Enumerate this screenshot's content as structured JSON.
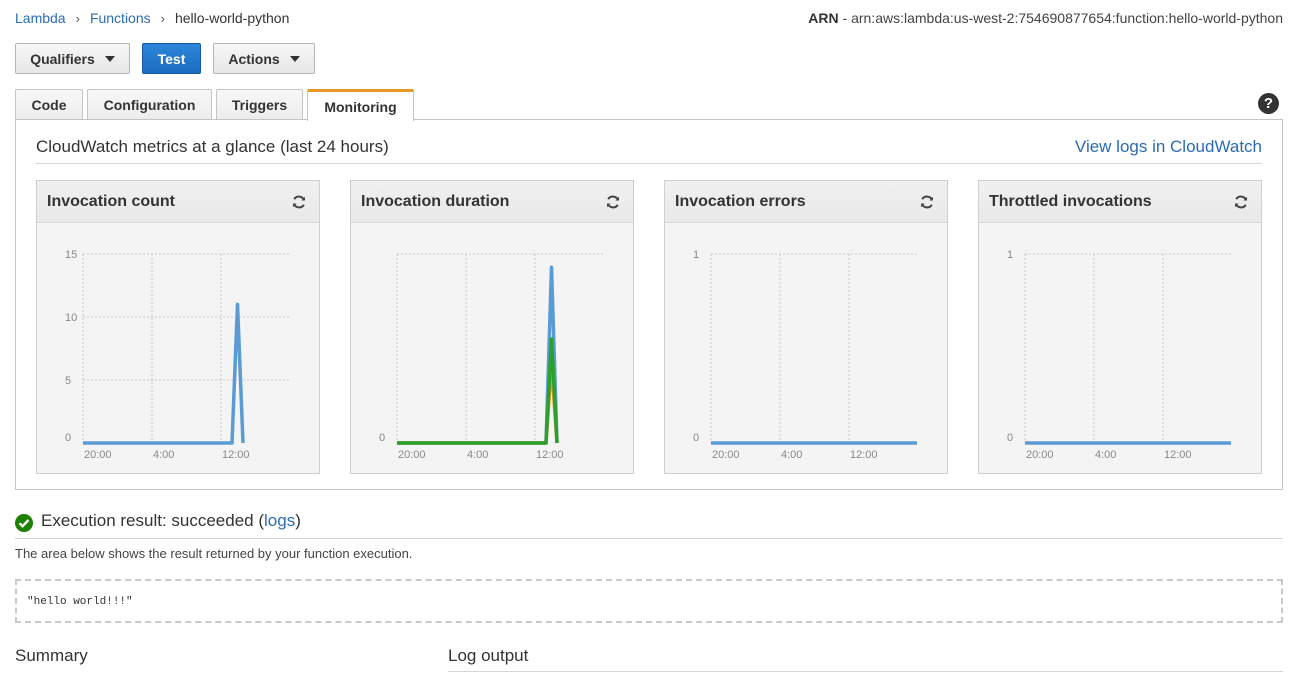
{
  "breadcrumb": {
    "lambda": "Lambda",
    "functions": "Functions",
    "current": "hello-world-python"
  },
  "arn": {
    "label": "ARN",
    "value": " - arn:aws:lambda:us-west-2:754690877654:function:hello-world-python"
  },
  "toolbar": {
    "qualifiers": "Qualifiers",
    "test": "Test",
    "actions": "Actions"
  },
  "tabs": {
    "code": "Code",
    "configuration": "Configuration",
    "triggers": "Triggers",
    "monitoring": "Monitoring"
  },
  "help_icon": "?",
  "monitoring": {
    "title": "CloudWatch metrics at a glance (last 24 hours)",
    "view_logs": "View logs in CloudWatch"
  },
  "colors": {
    "blue": "#5b9bd5",
    "green": "#2ca02c",
    "orange": "#e8941c",
    "accent": "#e79925",
    "link": "#2a6cb3"
  },
  "chart_data": [
    {
      "type": "line",
      "title": "Invocation count",
      "x_ticks": [
        "20:00",
        "4:00",
        "12:00"
      ],
      "y_ticks": [
        "0",
        "5",
        "10",
        "15"
      ],
      "ylim": [
        0,
        15
      ],
      "grid": true,
      "series": [
        {
          "color": "#5b9bd5",
          "values": [
            0,
            0,
            0,
            0,
            0,
            0,
            0,
            0,
            0,
            0,
            0,
            0,
            0,
            0,
            0,
            0,
            0,
            0,
            0,
            0,
            0,
            0,
            0,
            0,
            0,
            0,
            0,
            0,
            11,
            0
          ]
        }
      ]
    },
    {
      "type": "line",
      "title": "Invocation duration",
      "x_ticks": [
        "20:00",
        "4:00",
        "12:00"
      ],
      "y_ticks": [
        "0"
      ],
      "ylim": [
        0,
        100
      ],
      "grid": true,
      "series": [
        {
          "color": "#5b9bd5",
          "values": [
            0,
            0,
            0,
            0,
            0,
            0,
            0,
            0,
            0,
            0,
            0,
            0,
            0,
            0,
            0,
            0,
            0,
            0,
            0,
            0,
            0,
            0,
            0,
            0,
            0,
            0,
            0,
            0,
            93,
            0
          ]
        },
        {
          "color": "#e8941c",
          "values": [
            0,
            0,
            0,
            0,
            0,
            0,
            0,
            0,
            0,
            0,
            0,
            0,
            0,
            0,
            0,
            0,
            0,
            0,
            0,
            0,
            0,
            0,
            0,
            0,
            0,
            0,
            0,
            0,
            42,
            0
          ]
        },
        {
          "color": "#2ca02c",
          "values": [
            0,
            0,
            0,
            0,
            0,
            0,
            0,
            0,
            0,
            0,
            0,
            0,
            0,
            0,
            0,
            0,
            0,
            0,
            0,
            0,
            0,
            0,
            0,
            0,
            0,
            0,
            0,
            0,
            55,
            0
          ]
        }
      ]
    },
    {
      "type": "line",
      "title": "Invocation errors",
      "x_ticks": [
        "20:00",
        "4:00",
        "12:00"
      ],
      "y_ticks": [
        "0",
        "1"
      ],
      "ylim": [
        0,
        1
      ],
      "grid": true,
      "series": [
        {
          "color": "#5b9bd5",
          "values": [
            0,
            0,
            0,
            0,
            0,
            0,
            0,
            0,
            0,
            0,
            0,
            0,
            0,
            0,
            0,
            0,
            0,
            0,
            0,
            0,
            0,
            0,
            0,
            0,
            0,
            0,
            0,
            0,
            0,
            0
          ]
        }
      ]
    },
    {
      "type": "line",
      "title": "Throttled invocations",
      "x_ticks": [
        "20:00",
        "4:00",
        "12:00"
      ],
      "y_ticks": [
        "0",
        "1"
      ],
      "ylim": [
        0,
        1
      ],
      "grid": true,
      "series": [
        {
          "color": "#5b9bd5",
          "values": [
            0,
            0,
            0,
            0,
            0,
            0,
            0,
            0,
            0,
            0,
            0,
            0,
            0,
            0,
            0,
            0,
            0,
            0,
            0,
            0,
            0,
            0,
            0,
            0,
            0,
            0,
            0,
            0,
            0,
            0
          ]
        }
      ]
    }
  ],
  "execution": {
    "prefix": "Execution result: succeeded (",
    "logs_link": "logs",
    "suffix": ")",
    "description": "The area below shows the result returned by your function execution.",
    "result": "\"hello world!!!\""
  },
  "summary_title": "Summary",
  "log_output_title": "Log output"
}
